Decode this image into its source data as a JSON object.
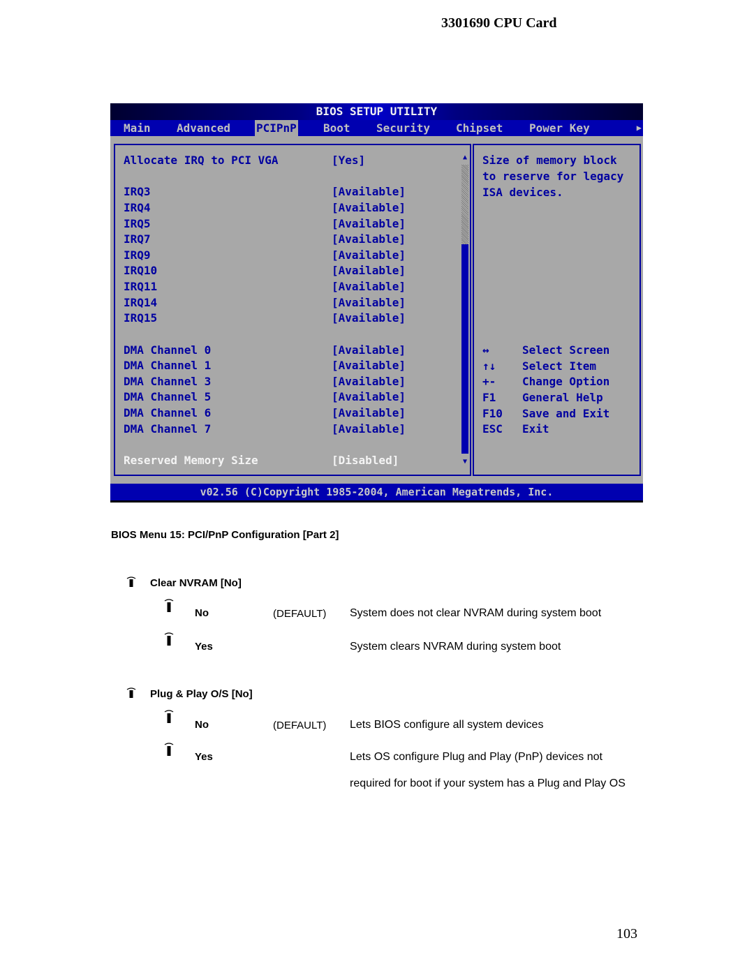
{
  "document": {
    "header_title": "3301690 CPU Card",
    "page_number": "103",
    "caption": "BIOS Menu 15: PCI/PnP Configuration [Part 2]"
  },
  "bios": {
    "title": "BIOS SETUP UTILITY",
    "menu_tabs": [
      {
        "label": "Main",
        "active": false
      },
      {
        "label": "Advanced",
        "active": false
      },
      {
        "label": "PCIPnP",
        "active": true
      },
      {
        "label": "Boot",
        "active": false
      },
      {
        "label": "Security",
        "active": false
      },
      {
        "label": "Chipset",
        "active": false
      },
      {
        "label": "Power Key",
        "active": false
      }
    ],
    "more_tabs_icon": "triangle-right-icon",
    "settings": [
      {
        "label": "Allocate IRQ to PCI VGA",
        "value": "[Yes]"
      },
      {
        "label": "IRQ3",
        "value": "[Available]"
      },
      {
        "label": "IRQ4",
        "value": "[Available]"
      },
      {
        "label": "IRQ5",
        "value": "[Available]"
      },
      {
        "label": "IRQ7",
        "value": "[Available]"
      },
      {
        "label": "IRQ9",
        "value": "[Available]"
      },
      {
        "label": "IRQ10",
        "value": "[Available]"
      },
      {
        "label": "IRQ11",
        "value": "[Available]"
      },
      {
        "label": "IRQ14",
        "value": "[Available]"
      },
      {
        "label": "IRQ15",
        "value": "[Available]"
      },
      {
        "label": "DMA Channel 0",
        "value": "[Available]"
      },
      {
        "label": "DMA Channel 1",
        "value": "[Available]"
      },
      {
        "label": "DMA Channel 3",
        "value": "[Available]"
      },
      {
        "label": "DMA Channel 5",
        "value": "[Available]"
      },
      {
        "label": "DMA Channel 6",
        "value": "[Available]"
      },
      {
        "label": "DMA Channel 7",
        "value": "[Available]"
      },
      {
        "label": "Reserved Memory Size",
        "value": "[Disabled]",
        "selected": true
      }
    ],
    "scrollbar": {
      "up_icon": "▲",
      "down_icon": "▼"
    },
    "help_text": "Size of memory block\nto reserve for legacy\nISA devices.",
    "key_legend": [
      {
        "key": "↔",
        "action": "Select Screen"
      },
      {
        "key": "↑↓",
        "action": "Select Item"
      },
      {
        "key": "+-",
        "action": "Change Option"
      },
      {
        "key": "F1",
        "action": "General Help"
      },
      {
        "key": "F10",
        "action": "Save and Exit"
      },
      {
        "key": "ESC",
        "action": "Exit"
      }
    ],
    "footer": "v02.56 (C)Copyright 1985-2004, American Megatrends, Inc.",
    "colors": {
      "background": "#a8a8a8",
      "accent_blue": "#0000b0",
      "text_blue": "#0000a0",
      "highlight_text": "#f4f4f4"
    }
  },
  "options": [
    {
      "heading": "Clear NVRAM [No]",
      "choices": [
        {
          "name": "No",
          "default_label": "(DEFAULT)",
          "is_default": true,
          "description": "System does not clear NVRAM during system boot"
        },
        {
          "name": "Yes",
          "default_label": "",
          "is_default": false,
          "description": "System clears NVRAM during system boot"
        }
      ]
    },
    {
      "heading": "Plug & Play O/S [No]",
      "choices": [
        {
          "name": "No",
          "default_label": "(DEFAULT)",
          "is_default": true,
          "description": "Lets BIOS configure all system devices"
        },
        {
          "name": "Yes",
          "default_label": "",
          "is_default": false,
          "description": "Lets OS configure Plug and Play (PnP) devices not required for boot if your system has a Plug and Play OS"
        }
      ]
    }
  ]
}
